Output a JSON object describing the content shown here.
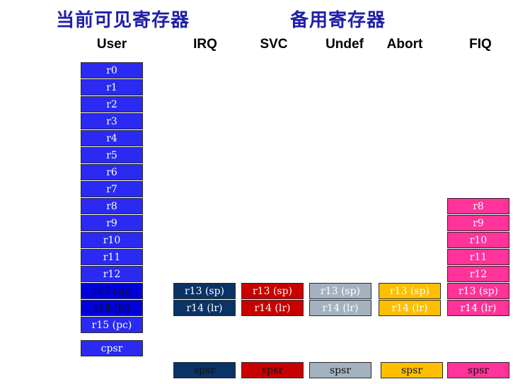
{
  "headings": {
    "current": "当前可见寄存器",
    "banked": "备用寄存器"
  },
  "colors": {
    "user": "#2a2af2",
    "user_dark": "#0000dd",
    "irq": "#0a3366",
    "svc": "#c80000",
    "undef": "#a4b2c0",
    "abort": "#ffbf00",
    "fiq": "#ff3399",
    "title": "#1f1fa8"
  },
  "modes": [
    {
      "key": "user",
      "label": "User"
    },
    {
      "key": "irq",
      "label": "IRQ"
    },
    {
      "key": "svc",
      "label": "SVC"
    },
    {
      "key": "undef",
      "label": "Undef"
    },
    {
      "key": "abort",
      "label": "Abort"
    },
    {
      "key": "fiq",
      "label": "FIQ"
    }
  ],
  "user": {
    "registers": [
      "r0",
      "r1",
      "r2",
      "r3",
      "r4",
      "r5",
      "r6",
      "r7",
      "r8",
      "r9",
      "r10",
      "r11",
      "r12",
      "r13 (sp)",
      "r14 (lr)",
      "r15 (pc)"
    ],
    "cpsr": "cpsr"
  },
  "banked": {
    "irq": {
      "registers": [
        "r13 (sp)",
        "r14 (lr)"
      ],
      "spsr": "spsr"
    },
    "svc": {
      "registers": [
        "r13 (sp)",
        "r14 (lr)"
      ],
      "spsr": "spsr"
    },
    "undef": {
      "registers": [
        "r13 (sp)",
        "r14 (lr)"
      ],
      "spsr": "spsr"
    },
    "abort": {
      "registers": [
        "r13 (sp)",
        "r14 (lr)"
      ],
      "spsr": "spsr"
    },
    "fiq": {
      "registers": [
        "r8",
        "r9",
        "r10",
        "r11",
        "r12",
        "r13 (sp)",
        "r14 (lr)"
      ],
      "spsr": "spsr"
    }
  }
}
